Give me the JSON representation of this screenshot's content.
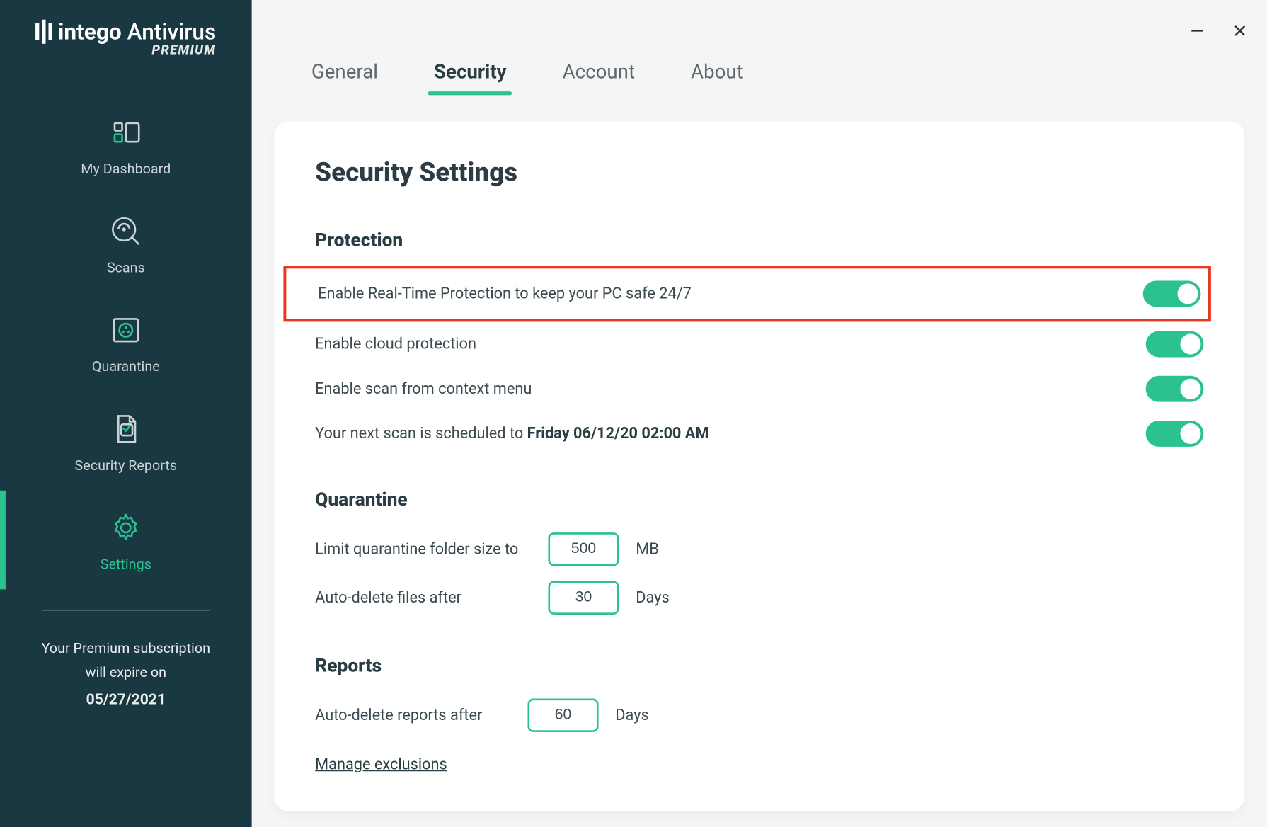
{
  "logo": {
    "brand_bold": "intego",
    "brand_rest": "Antivirus",
    "tier": "PREMIUM"
  },
  "sidebar": {
    "items": [
      {
        "label": "My Dashboard"
      },
      {
        "label": "Scans"
      },
      {
        "label": "Quarantine"
      },
      {
        "label": "Security Reports"
      },
      {
        "label": "Settings"
      }
    ],
    "subscription_line1": "Your Premium subscription",
    "subscription_line2": "will expire on",
    "subscription_date": "05/27/2021"
  },
  "tabs": [
    {
      "label": "General"
    },
    {
      "label": "Security"
    },
    {
      "label": "Account"
    },
    {
      "label": "About"
    }
  ],
  "panel": {
    "title": "Security Settings",
    "sections": {
      "protection": {
        "title": "Protection",
        "realtime_label": "Enable Real-Time Protection to keep your PC safe 24/7",
        "cloud_label": "Enable cloud protection",
        "context_label": "Enable scan from context menu",
        "next_scan_prefix": "Your next scan is scheduled to ",
        "next_scan_value": "Friday 06/12/20 02:00 AM",
        "toggles": {
          "realtime": "on",
          "cloud": "on",
          "context": "on",
          "schedule": "on"
        }
      },
      "quarantine": {
        "title": "Quarantine",
        "limit_label": "Limit quarantine folder size to",
        "limit_value": "500",
        "limit_unit": "MB",
        "autodelete_label": "Auto-delete files after",
        "autodelete_value": "30",
        "autodelete_unit": "Days"
      },
      "reports": {
        "title": "Reports",
        "autodelete_label": "Auto-delete reports after",
        "autodelete_value": "60",
        "autodelete_unit": "Days",
        "manage_exclusions": "Manage exclusions"
      }
    }
  }
}
